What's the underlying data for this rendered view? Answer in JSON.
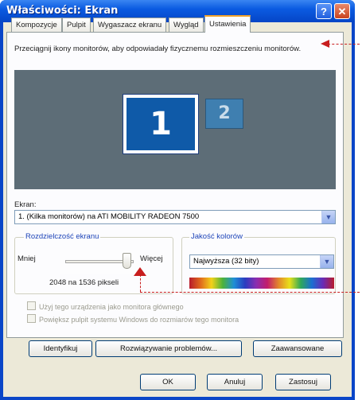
{
  "window": {
    "title": "Właściwości: Ekran",
    "help_button": "?",
    "close_button": "✕"
  },
  "tabs": [
    {
      "label": "Kompozycje"
    },
    {
      "label": "Pulpit"
    },
    {
      "label": "Wygaszacz ekranu"
    },
    {
      "label": "Wygląd"
    },
    {
      "label": "Ustawienia",
      "active": true
    }
  ],
  "instruction": "Przeciągnij ikony monitorów, aby odpowiadały fizycznemu rozmieszczeniu monitorów.",
  "monitors": {
    "primary": "1",
    "secondary": "2"
  },
  "screen": {
    "label": "Ekran:",
    "value": "1. (Kilka monitorów) na ATI MOBILITY RADEON 7500"
  },
  "resolution": {
    "title": "Rozdzielczość ekranu",
    "less_label": "Mniej",
    "more_label": "Więcej",
    "value_text": "2048 na 1536 pikseli",
    "slider_level": 0.9
  },
  "color_quality": {
    "title": "Jakość kolorów",
    "value": "Najwyższa (32 bity)"
  },
  "checkboxes": [
    {
      "label": "Użyj tego urządzenia jako monitora głównego",
      "checked": false
    },
    {
      "label": "Powiększ pulpit systemu Windows do rozmiarów tego monitora",
      "checked": false
    }
  ],
  "panel_buttons": {
    "identify": "Identyfikuj",
    "troubleshoot": "Rozwiązywanie problemów...",
    "advanced": "Zaawansowane"
  },
  "dialog_buttons": {
    "ok": "OK",
    "cancel": "Anuluj",
    "apply": "Zastosuj"
  },
  "colors": {
    "titlebar": "#0b5be1",
    "active_tab_accent": "#f2a22a",
    "monitor_area": "#5d6d77",
    "annotation": "#c81e1e"
  }
}
